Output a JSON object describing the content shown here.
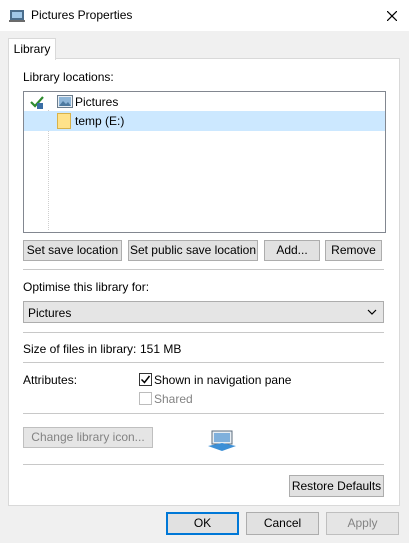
{
  "window": {
    "title": "Pictures Properties"
  },
  "tabs": [
    {
      "label": "Library"
    }
  ],
  "library_locations": {
    "label": "Library locations:",
    "items": [
      {
        "name": "Pictures",
        "icon": "pictures-folder-icon",
        "default_save": true
      },
      {
        "name": "temp (E:)",
        "icon": "folder-icon",
        "selected": true
      }
    ]
  },
  "buttons": {
    "set_save_location": "Set save location",
    "set_public_save_location": "Set public save location",
    "add": "Add...",
    "remove": "Remove",
    "change_icon": "Change library icon...",
    "restore_defaults": "Restore Defaults",
    "ok": "OK",
    "cancel": "Cancel",
    "apply": "Apply"
  },
  "optimise": {
    "label": "Optimise this library for:",
    "value": "Pictures"
  },
  "size": {
    "label": "Size of files in library:",
    "value": "151 MB"
  },
  "attributes": {
    "label": "Attributes:",
    "shown_in_nav": {
      "label": "Shown in navigation pane",
      "checked": true
    },
    "shared": {
      "label": "Shared",
      "checked": false,
      "disabled": true
    }
  },
  "colors": {
    "selection": "#cce8ff",
    "accent": "#0078d7"
  }
}
